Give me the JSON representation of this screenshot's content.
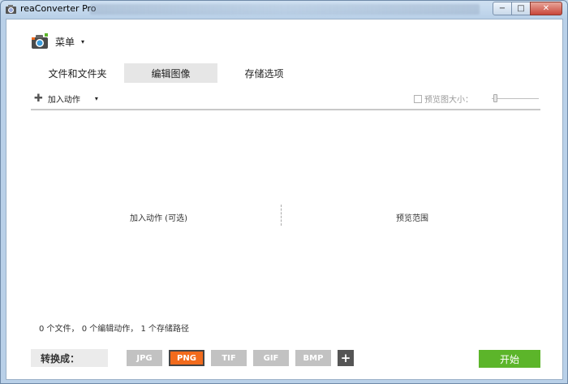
{
  "window": {
    "title": "reaConverter Pro",
    "minimize_label": "−",
    "maximize_label": "□",
    "close_label": "✕"
  },
  "menu": {
    "label": "菜单",
    "caret": "▾"
  },
  "tabs": [
    {
      "label": "文件和文件夹",
      "active": false
    },
    {
      "label": "编辑图像",
      "active": true
    },
    {
      "label": "存储选项",
      "active": false
    }
  ],
  "toolbar": {
    "add_action_label": "加入动作",
    "add_action_caret": "▾",
    "preview_size_label": "预览图大小："
  },
  "panes": {
    "left_label": "加入动作 (可选)",
    "right_label": "预览范围"
  },
  "status": {
    "text": "0 个文件， 0 个编辑动作， 1 个存储路径"
  },
  "convert": {
    "label": "转换成：",
    "formats": [
      {
        "label": "JPG",
        "active": false
      },
      {
        "label": "PNG",
        "active": true
      },
      {
        "label": "TIF",
        "active": false
      },
      {
        "label": "GIF",
        "active": false
      },
      {
        "label": "BMP",
        "active": false
      }
    ],
    "add_label": "+",
    "start_label": "开始"
  },
  "colors": {
    "accent_orange": "#f26b1d",
    "start_green": "#5cb52a",
    "format_gray": "#c2c2c2"
  }
}
